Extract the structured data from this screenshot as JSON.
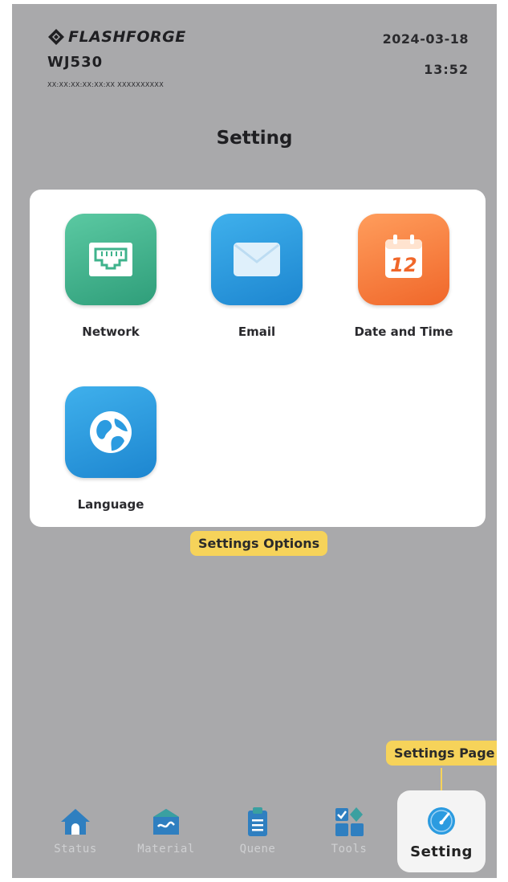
{
  "header": {
    "brand": "FLASHFORGE",
    "model": "WJ530",
    "serial": "XX:XX:XX:XX:XX:XX   XXXXXXXXXX",
    "date": "2024-03-18",
    "time": "13:52"
  },
  "page": {
    "title": "Setting"
  },
  "settings": {
    "options": [
      {
        "label": "Network",
        "icon": "ethernet-icon"
      },
      {
        "label": "Email",
        "icon": "envelope-icon"
      },
      {
        "label": "Date and Time",
        "icon": "calendar-icon",
        "calendar_day": "12"
      },
      {
        "label": "Language",
        "icon": "globe-icon"
      }
    ]
  },
  "callouts": {
    "options": "Settings Options",
    "page": "Settings Page"
  },
  "nav": {
    "items": [
      {
        "label": "Status",
        "icon": "home-icon"
      },
      {
        "label": "Material",
        "icon": "material-icon"
      },
      {
        "label": "Quene",
        "icon": "clipboard-icon"
      },
      {
        "label": "Tools",
        "icon": "tools-icon"
      },
      {
        "label": "Setting",
        "icon": "gauge-icon",
        "active": true
      }
    ]
  },
  "colors": {
    "screen_bg": "#a9a9ab",
    "callout": "#f6d35a",
    "green_tile": "#3fb38c",
    "blue_tile": "#2b9be0",
    "orange_tile": "#f7803f",
    "nav_icon": "#2f7fc0"
  }
}
